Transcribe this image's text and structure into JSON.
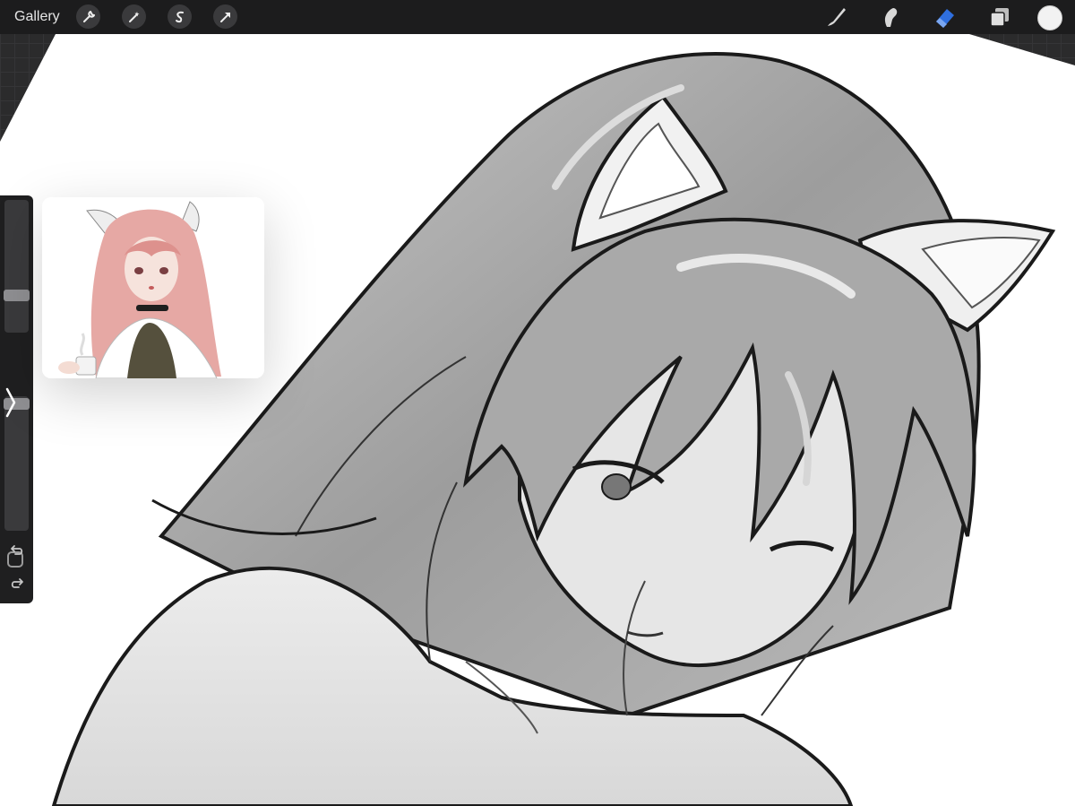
{
  "topbar": {
    "gallery_label": "Gallery",
    "left_tools": [
      "wrench-icon",
      "magic-wand-icon",
      "selection-icon",
      "transform-icon"
    ],
    "right_tools": [
      "brush-icon",
      "smudge-icon",
      "eraser-icon",
      "layers-icon"
    ],
    "active_tool": "eraser-icon",
    "active_color": "#f2f2f2",
    "accent": "#2f6fdf"
  },
  "sidebar": {
    "brush_size_level": 0.55,
    "brush_opacity_level": 0.0,
    "icons": [
      "modify-square-icon",
      "collapse-chevron-icon",
      "undo-icon",
      "redo-icon"
    ]
  },
  "reference_window": {
    "content": "reference-image"
  }
}
